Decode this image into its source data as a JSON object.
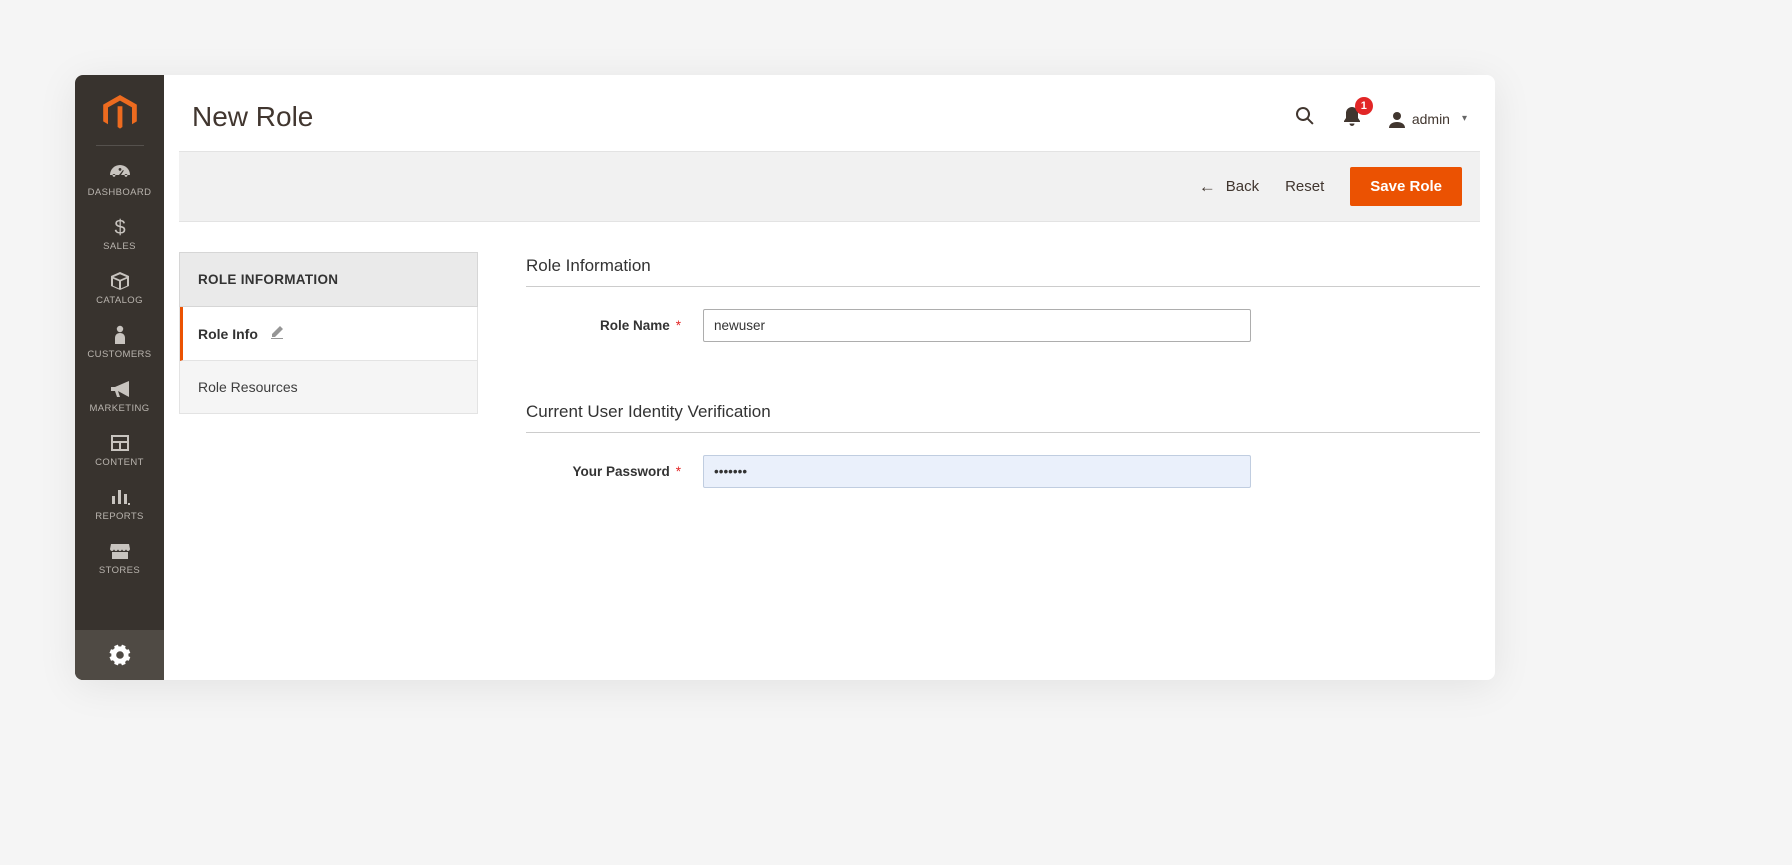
{
  "sidebar": {
    "items": [
      {
        "label": "Dashboard"
      },
      {
        "label": "Sales"
      },
      {
        "label": "Catalog"
      },
      {
        "label": "Customers"
      },
      {
        "label": "Marketing"
      },
      {
        "label": "Content"
      },
      {
        "label": "Reports"
      },
      {
        "label": "Stores"
      }
    ]
  },
  "header": {
    "title": "New Role",
    "notif_count": "1",
    "user_name": "admin"
  },
  "actions": {
    "back": "Back",
    "reset": "Reset",
    "save": "Save Role"
  },
  "tabs": {
    "header": "Role Information",
    "items": [
      {
        "label": "Role Info",
        "active": true
      },
      {
        "label": "Role Resources",
        "active": false
      }
    ]
  },
  "form": {
    "section1_title": "Role Information",
    "role_name_label": "Role Name",
    "role_name_value": "newuser",
    "section2_title": "Current User Identity Verification",
    "password_label": "Your Password",
    "password_value": "•••••••"
  }
}
